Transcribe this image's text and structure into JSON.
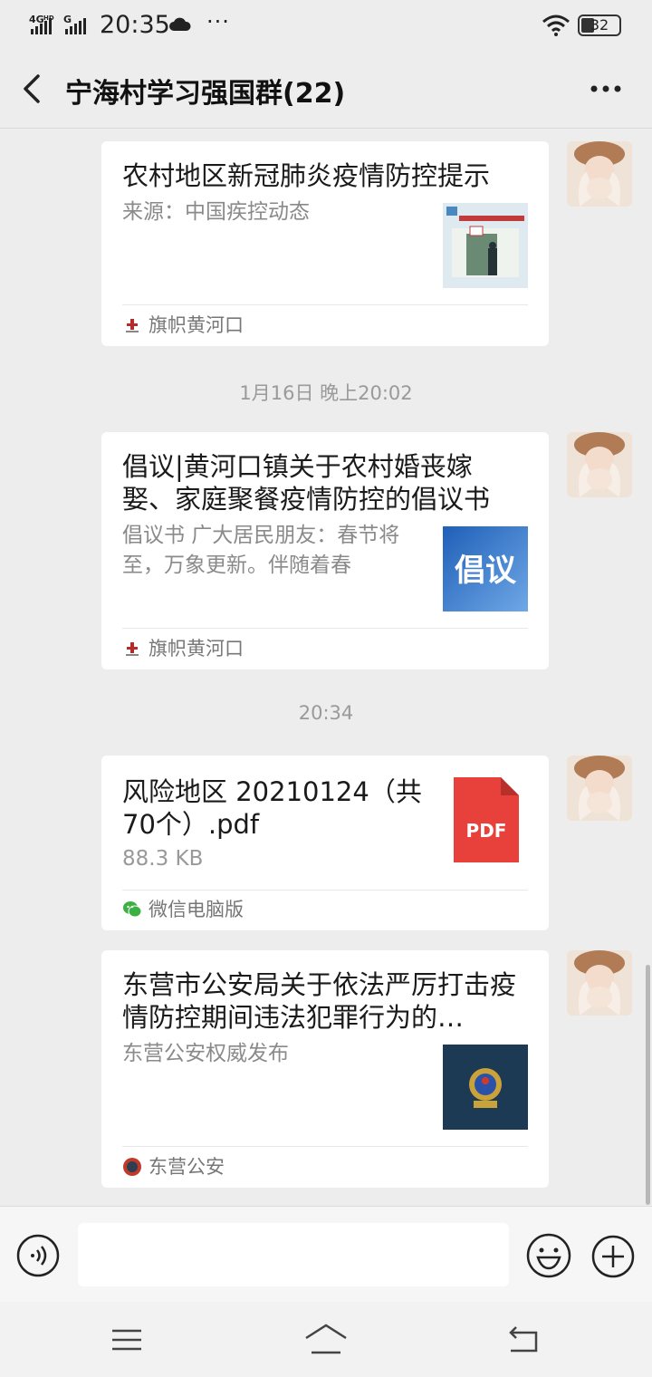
{
  "status_bar": {
    "network": "4G",
    "network_sup": "HD",
    "network2": "G",
    "time": "20:35",
    "more": "···",
    "battery": "32"
  },
  "header": {
    "title": "宁海村学习强国群(22)"
  },
  "messages": [
    {
      "type": "article",
      "title": "农村地区新冠肺炎疫情防控提示",
      "desc": "来源：中国疾控动态",
      "source": "旗帜黄河口"
    },
    {
      "type": "timestamp",
      "text": "1月16日 晚上20:02"
    },
    {
      "type": "article",
      "title": "倡议|黄河口镇关于农村婚丧嫁娶、家庭聚餐疫情防控的倡议书",
      "desc": "倡议书 广大居民朋友：春节将至，万象更新。伴随着春",
      "thumb_text": "倡议",
      "source": "旗帜黄河口"
    },
    {
      "type": "timestamp",
      "text": "20:34"
    },
    {
      "type": "file",
      "title": "风险地区 20210124（共70个）.pdf",
      "size": "88.3 KB",
      "file_icon_label": "PDF",
      "source": "微信电脑版"
    },
    {
      "type": "article",
      "title": "东营市公安局关于依法严厉打击疫情防控期间违法犯罪行为的…",
      "desc": "东营公安权威发布",
      "source": "东营公安"
    }
  ],
  "colors": {
    "background": "#ededed",
    "card": "#ffffff",
    "pdf_red": "#e8403a",
    "wechat_green": "#3cb043"
  },
  "icons": [
    "back-arrow-icon",
    "more-dots-icon",
    "voice-icon",
    "emoji-icon",
    "plus-icon",
    "menu-icon",
    "home-icon",
    "back-nav-icon"
  ]
}
